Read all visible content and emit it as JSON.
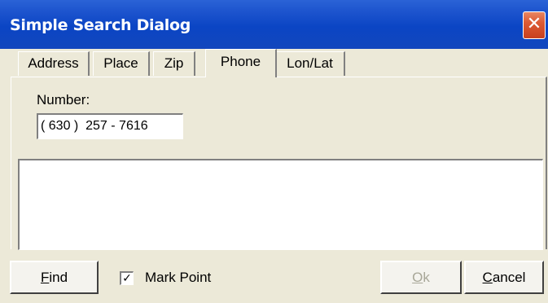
{
  "window": {
    "title": "Simple Search Dialog",
    "close_glyph": "✕"
  },
  "tabs": [
    {
      "label": "Address",
      "active": false
    },
    {
      "label": "Place",
      "active": false
    },
    {
      "label": "Zip",
      "active": false
    },
    {
      "label": "Phone",
      "active": true
    },
    {
      "label": "Lon/Lat",
      "active": false
    }
  ],
  "phone_tab": {
    "number_label": "Number:",
    "number_value": "( 630 )  257 - 7616"
  },
  "footer": {
    "find": {
      "mnemonic": "F",
      "rest": "ind"
    },
    "mark_point": {
      "label": "Mark Point",
      "checked": true,
      "check_glyph": "✓"
    },
    "ok": {
      "mnemonic": "O",
      "rest": "k",
      "enabled": false
    },
    "cancel": {
      "mnemonic": "C",
      "rest": "ancel"
    }
  },
  "colors": {
    "titlebar": "#0b45c4",
    "dialog_bg": "#ece9d8",
    "close_button": "#dc5a34"
  }
}
